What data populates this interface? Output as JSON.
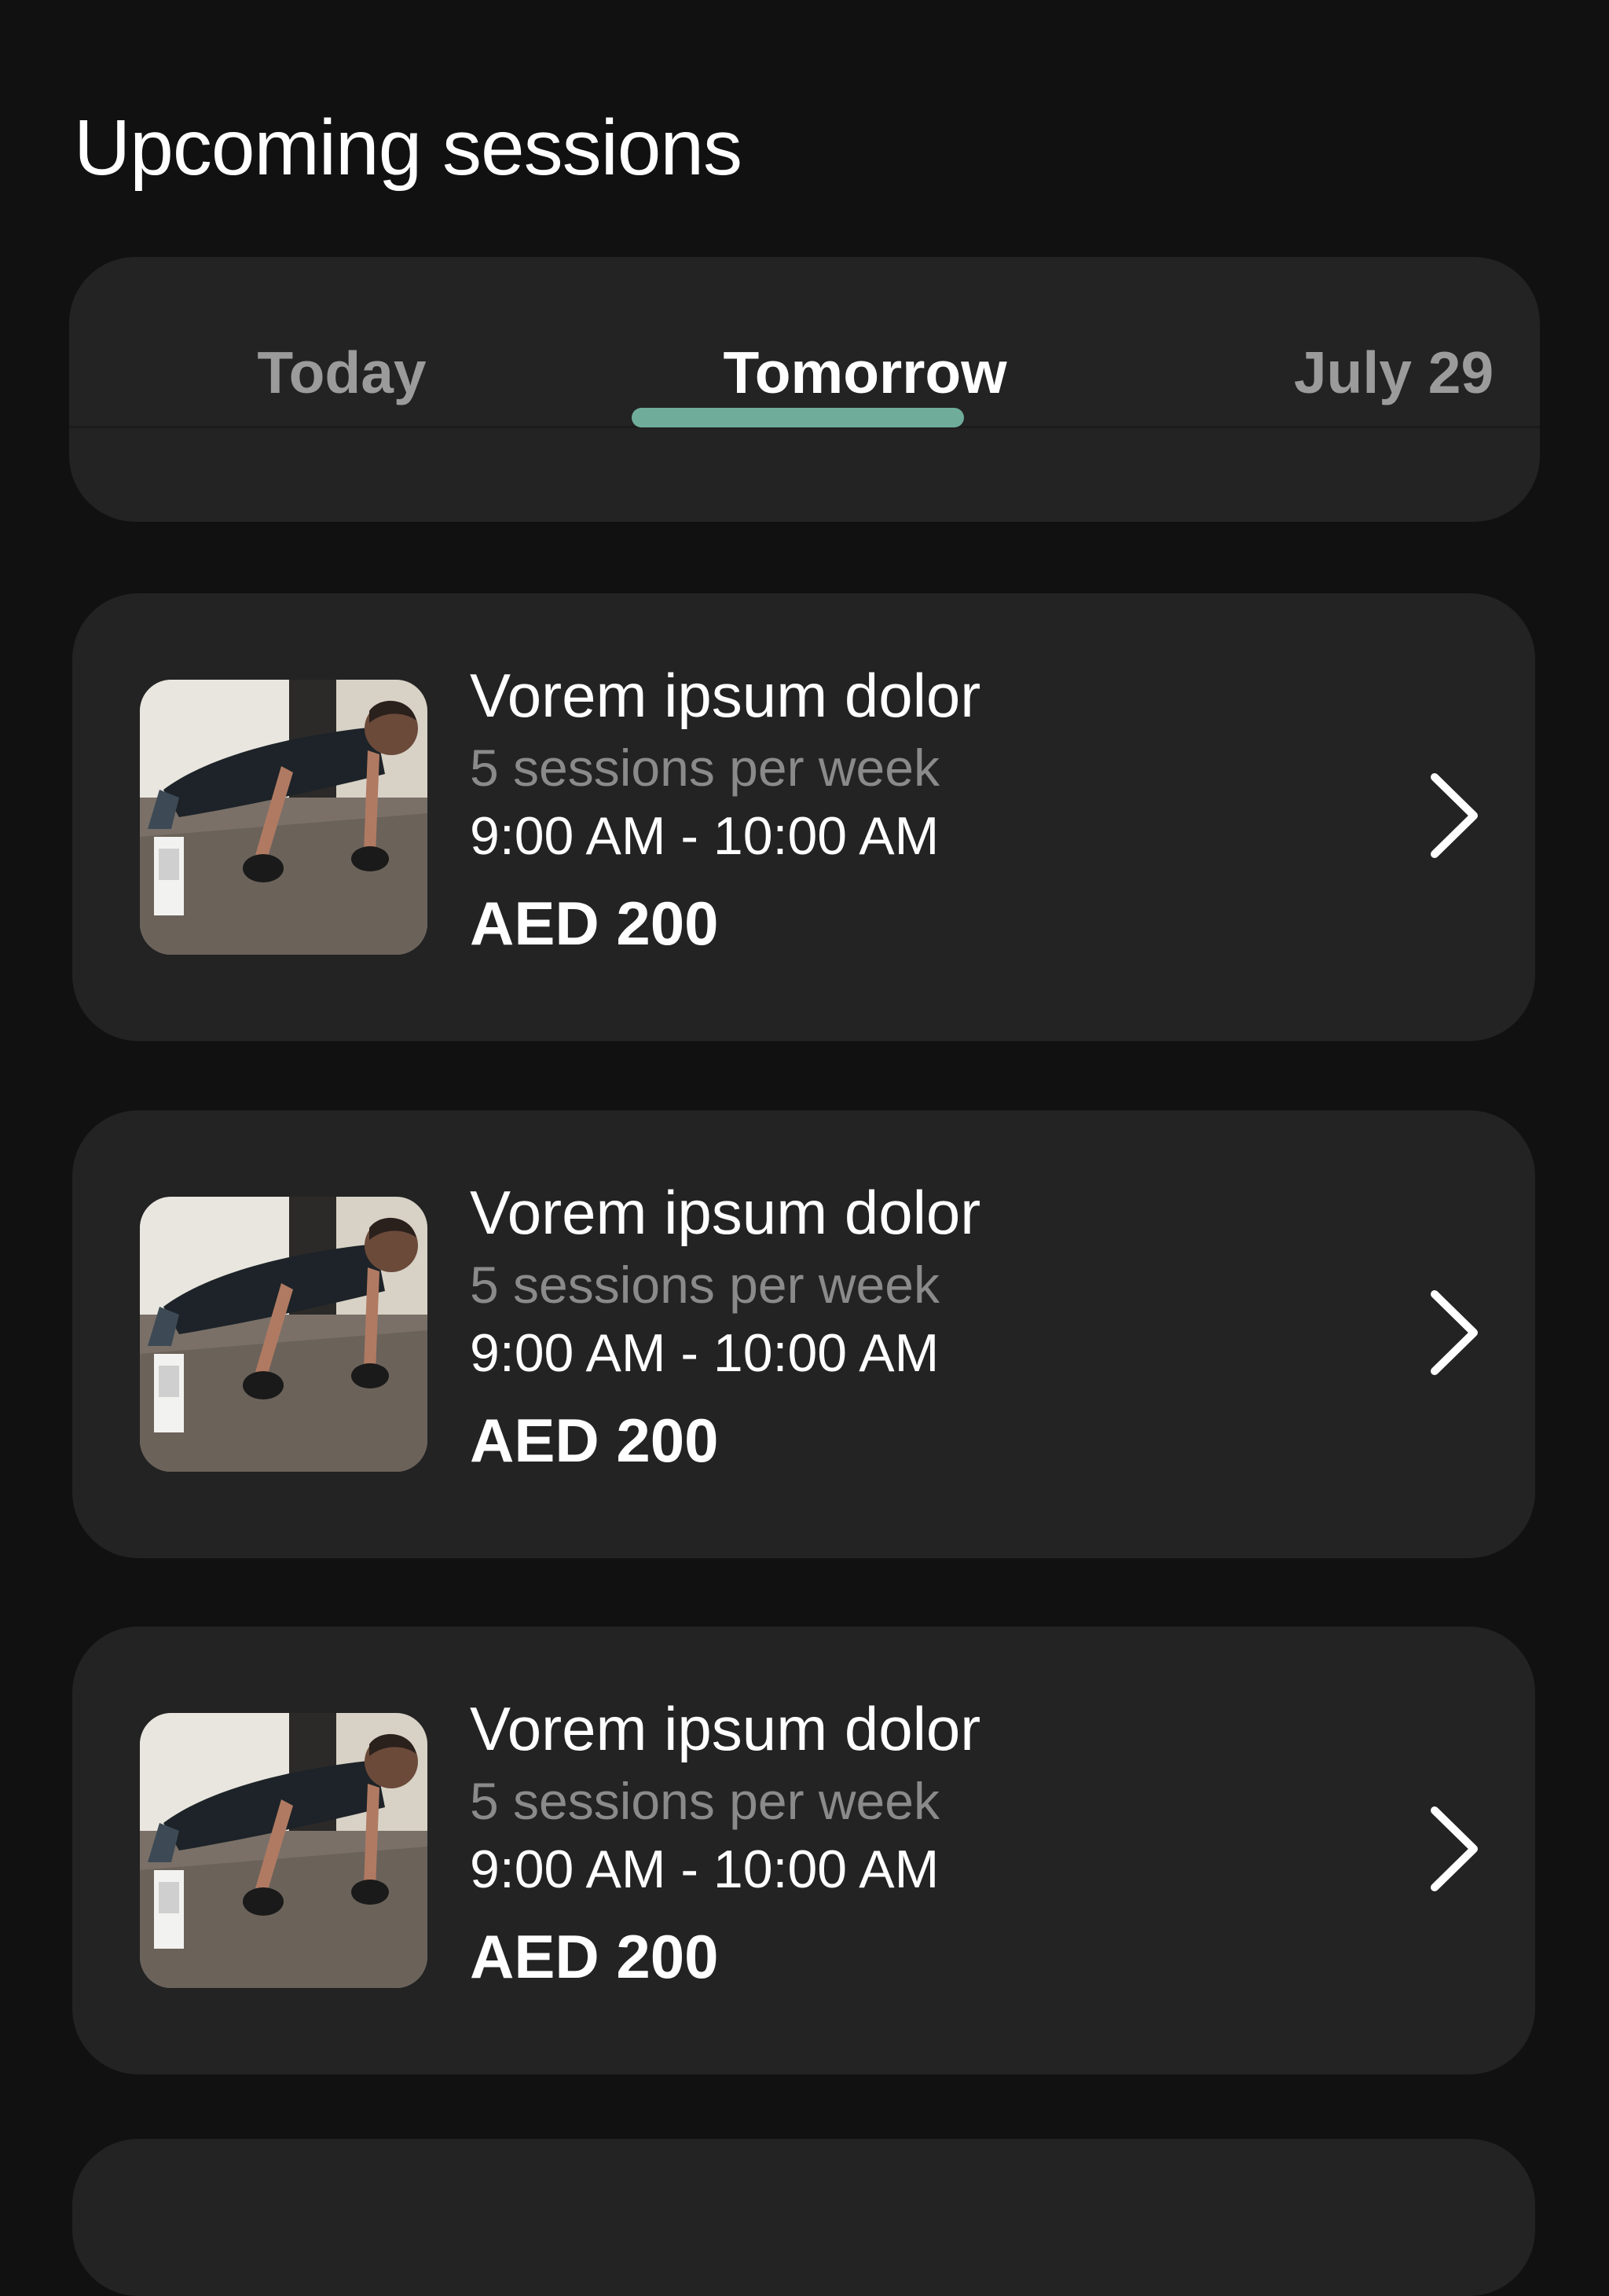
{
  "page": {
    "title": "Upcoming sessions"
  },
  "tabs": [
    {
      "label": "Today",
      "active": false
    },
    {
      "label": "Tomorrow",
      "active": true
    },
    {
      "label": "July 29",
      "active": false
    }
  ],
  "theme": {
    "background": "#111111",
    "card": "#232323",
    "accent": "#6fad9a",
    "muted_text": "#8a8a8a"
  },
  "sessions": [
    {
      "title": "Vorem ipsum dolor",
      "frequency": "5 sessions per week",
      "time": "9:00 AM - 10:00 AM",
      "price": "AED 200",
      "thumbnail": "push-up-workout-photo",
      "action_icon": "chevron-right-icon"
    },
    {
      "title": "Vorem ipsum dolor",
      "frequency": "5 sessions per week",
      "time": "9:00 AM - 10:00 AM",
      "price": "AED 200",
      "thumbnail": "push-up-workout-photo",
      "action_icon": "chevron-right-icon"
    },
    {
      "title": "Vorem ipsum dolor",
      "frequency": "5 sessions per week",
      "time": "9:00 AM - 10:00 AM",
      "price": "AED 200",
      "thumbnail": "push-up-workout-photo",
      "action_icon": "chevron-right-icon"
    }
  ]
}
